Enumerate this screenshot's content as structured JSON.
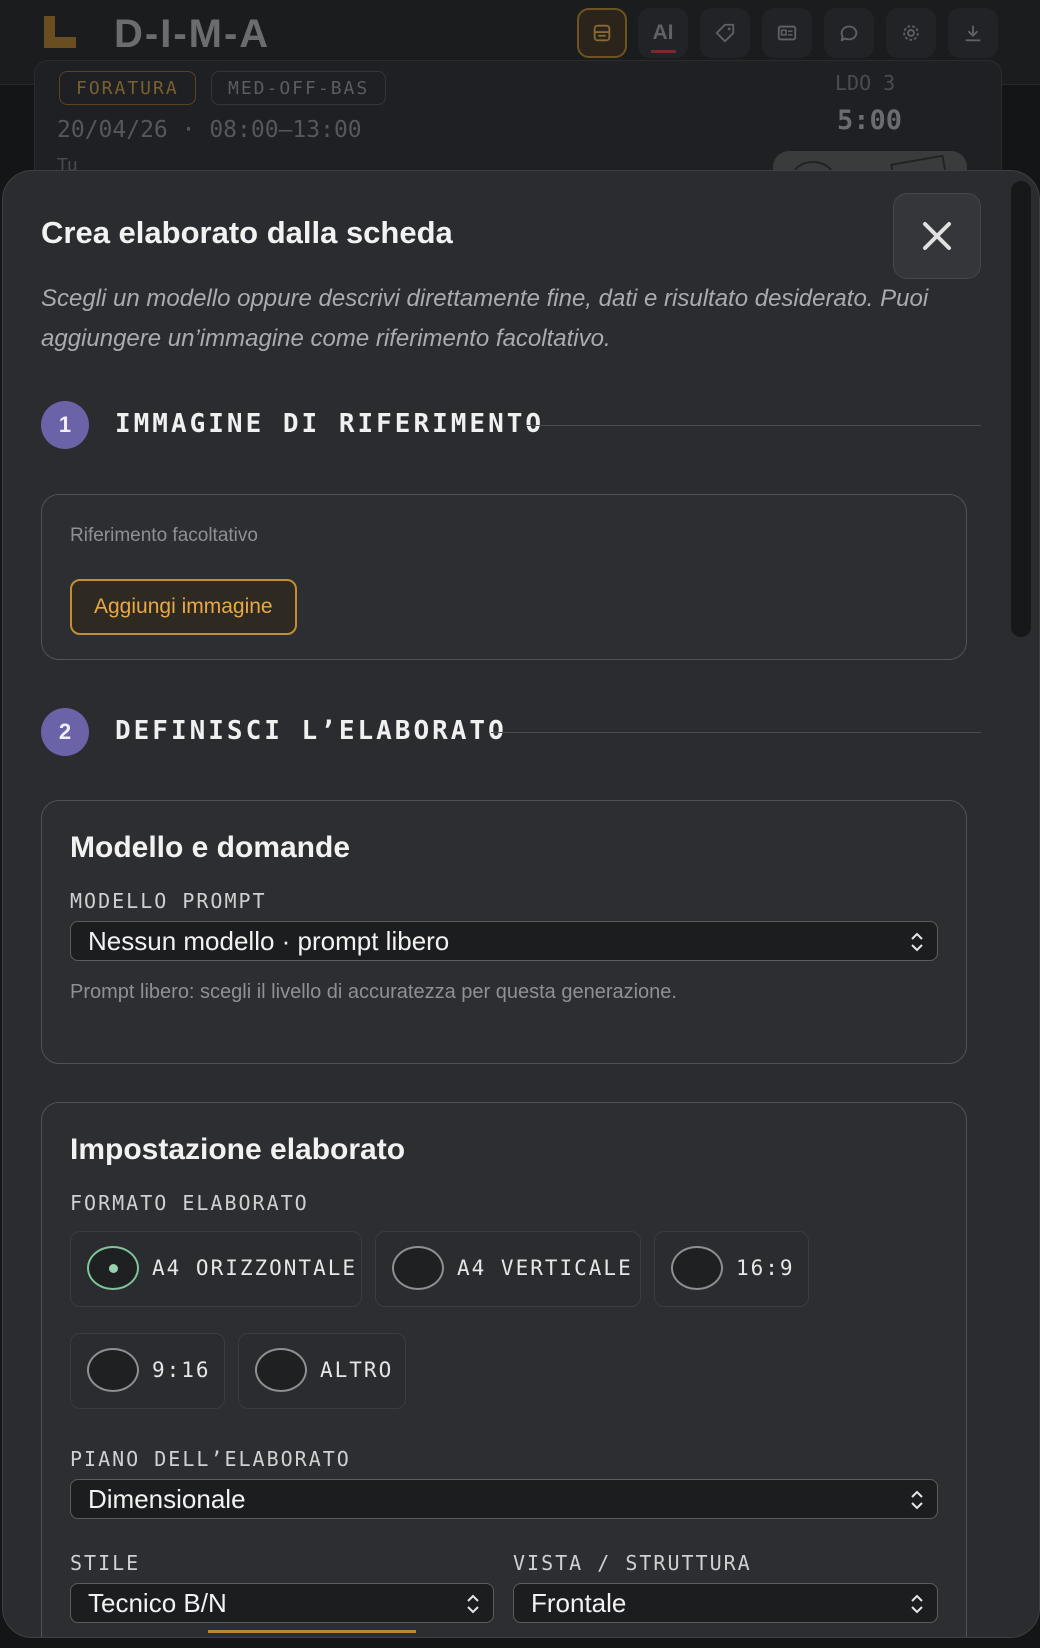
{
  "app": {
    "name": "D-I-M-A",
    "toolbar": {
      "buttons": [
        {
          "icon": "card-icon",
          "active": true
        },
        {
          "icon": "ai-label",
          "label": "AI"
        },
        {
          "icon": "tag-icon"
        },
        {
          "icon": "id-card-icon"
        },
        {
          "icon": "chat-icon"
        },
        {
          "icon": "gear-icon"
        },
        {
          "icon": "download-icon"
        }
      ]
    }
  },
  "background_card": {
    "tag1": "FORATURA",
    "tag2": "MED-OFF-BAS",
    "date": "20/04/26 · 08:00–13:00",
    "extra": "Tu",
    "time_top": "LDO 3",
    "time": "5:00"
  },
  "modal": {
    "title": "Crea elaborato dalla scheda",
    "description": "Scegli un modello oppure descrivi direttamente fine, dati e risultato desiderato. Puoi aggiungere un’immagine come riferimento facoltativo.",
    "close_icon": "close-icon",
    "step1": {
      "number": "1",
      "label": "IMMAGINE DI RIFERIMENTO",
      "hint": "Riferimento facoltativo",
      "add_button": "Aggiungi immagine"
    },
    "step2": {
      "number": "2",
      "label": "DEFINISCI L’ELABORATO",
      "model_panel": {
        "heading": "Modello e domande",
        "field_label": "MODELLO PROMPT",
        "select_value": "Nessun modello · prompt libero",
        "help": "Prompt libero: scegli il livello di accuratezza per questa generazione."
      },
      "settings_panel": {
        "heading": "Impostazione elaborato",
        "format_label": "FORMATO ELABORATO",
        "formats": [
          {
            "label": "A4 ORIZZONTALE",
            "selected": true
          },
          {
            "label": "A4 VERTICALE",
            "selected": false
          },
          {
            "label": "16:9",
            "selected": false
          },
          {
            "label": "9:16",
            "selected": false
          },
          {
            "label": "ALTRO",
            "selected": false
          }
        ],
        "plane_label": "PIANO DELL’ELABORATO",
        "plane_value": "Dimensionale",
        "style_label": "STILE",
        "style_value": "Tecnico B/N",
        "view_label": "VISTA / STRUTTURA",
        "view_value": "Frontale"
      }
    }
  },
  "colors": {
    "accent_orange": "#c48d33",
    "step_purple": "#6b63a8",
    "radio_selected": "#7fc39a"
  }
}
